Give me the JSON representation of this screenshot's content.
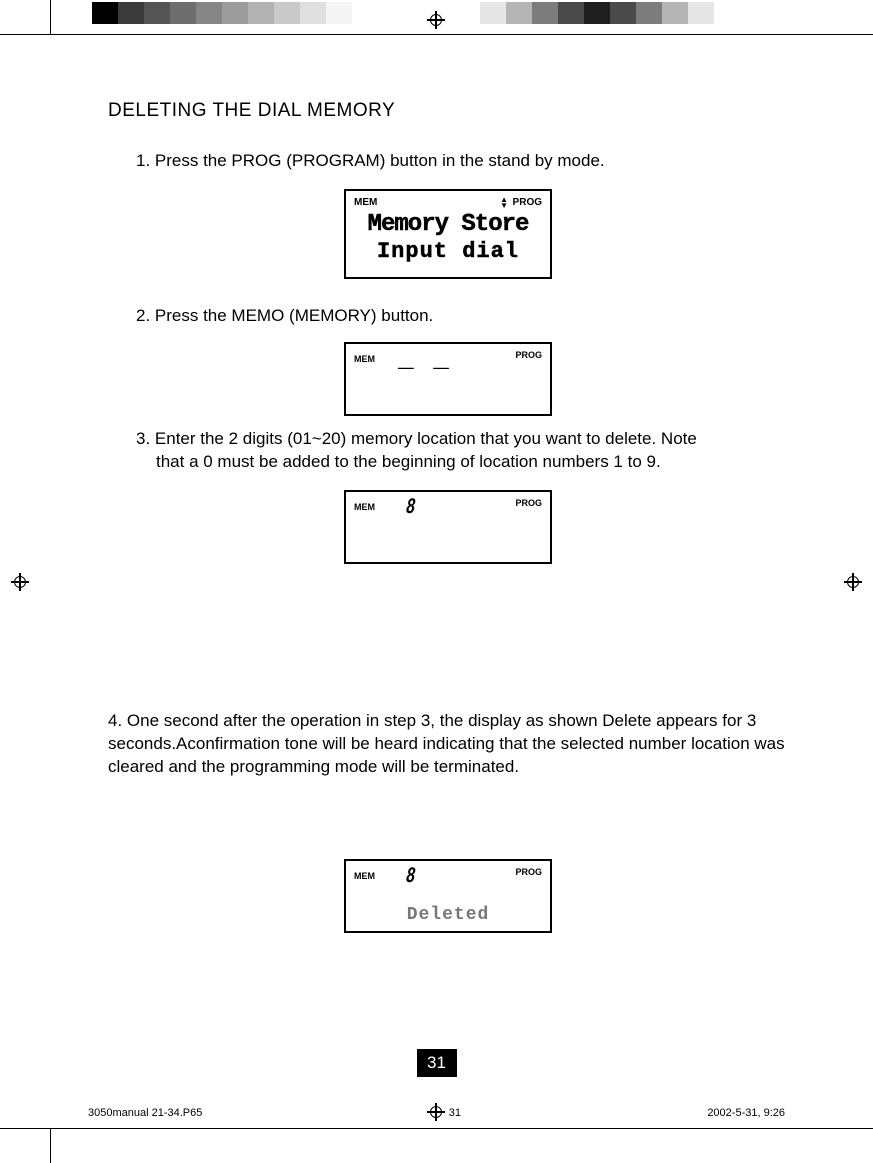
{
  "swatches_left": [
    "#000000",
    "#3a3a3a",
    "#555555",
    "#6e6e6e",
    "#858585",
    "#9c9c9c",
    "#b2b2b2",
    "#c9c9c9",
    "#dfdfdf",
    "#f5f5f5",
    "#ffffff"
  ],
  "swatches_right": [
    "#ffffff",
    "#e6e6e6",
    "#b5b5b5",
    "#7c7c7c",
    "#4a4a4a",
    "#1e1e1e",
    "#4a4a4a",
    "#7c7c7c",
    "#b5b5b5",
    "#e6e6e6",
    "#ffffff"
  ],
  "heading": "DELETING THE DIAL MEMORY",
  "steps": {
    "s1": "1. Press the PROG (PROGRAM) button in the stand by mode.",
    "s2": "2. Press the MEMO (MEMORY) button.",
    "s3a": "3. Enter the 2 digits (01~20) memory location that you want to delete. Note",
    "s3b": "that a 0 must be added to the beginning of location numbers 1 to 9.",
    "s4": "4.  One second after the operation in step 3, the display as shown Delete appears for 3 seconds.Aconfirmation tone will be heard indicating that the selected number location was cleared and the programming mode will be terminated."
  },
  "lcd": {
    "mem": "MEM",
    "prog": "PROG",
    "line1": "Memory Store",
    "line2": "Input dial",
    "dashes": "_ _",
    "digit": "8",
    "deleted": "Deleted"
  },
  "page_number": "31",
  "footer": {
    "file": "3050manual 21-34.P65",
    "page": "31",
    "date": "2002-5-31, 9:26"
  }
}
